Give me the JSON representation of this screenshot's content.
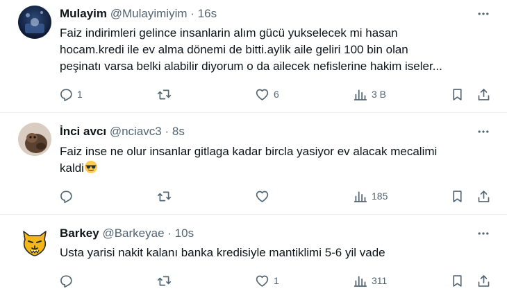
{
  "tweets": [
    {
      "name": "Mulayim",
      "handle": "@Mulayimiyim",
      "separator": "·",
      "time": "16s",
      "lines": [
        "Faiz indirimleri gelince insanlarin alım gücü yukselecek mi hasan",
        "hocam.kredi ile ev alma dönemi de bitti.aylik aile  geliri 100 bin olan",
        "peşinatı varsa belki alabilir diyorum o da ailecek nefislerine hakim iseler..."
      ],
      "replies": "1",
      "retweets": "",
      "likes": "6",
      "views": "3 B"
    },
    {
      "name": "İnci avcı",
      "handle": "@nciavc3",
      "separator": "·",
      "time": "8s",
      "lines": [
        "Faiz inse ne olur insanlar gitlaga kadar bircla yasiyor ev alacak mecalimi",
        "kaldi"
      ],
      "emoji": "smiling-face-with-sunglasses",
      "replies": "",
      "retweets": "",
      "likes": "",
      "views": "185"
    },
    {
      "name": "Barkey",
      "handle": "@Barkeyae",
      "separator": "·",
      "time": "10s",
      "lines": [
        "Usta yarisi nakit kalanı banka kredisiyle mantiklimi 5-6 yil vade"
      ],
      "replies": "",
      "retweets": "",
      "likes": "1",
      "views": "311"
    }
  ],
  "colors": {
    "text": "#0f1419",
    "secondary": "#536471",
    "divider": "#eff3f4"
  },
  "icons": [
    "reply-icon",
    "retweet-icon",
    "like-icon",
    "views-icon",
    "bookmark-icon",
    "share-icon",
    "more-icon"
  ]
}
